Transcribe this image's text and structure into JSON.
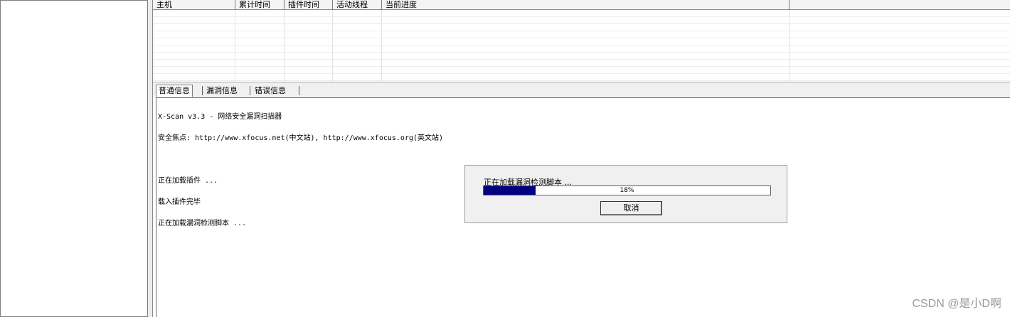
{
  "host_list": {
    "columns": [
      "主机",
      "累计时间",
      "插件时间",
      "活动线程",
      "当前进度",
      ""
    ],
    "rows": []
  },
  "tabs": [
    {
      "label": "普通信息",
      "active": true
    },
    {
      "label": "漏洞信息",
      "active": false
    },
    {
      "label": "错误信息",
      "active": false
    }
  ],
  "log": {
    "lines": [
      "X-Scan v3.3 - 网络安全漏洞扫描器",
      "安全焦点: http://www.xfocus.net(中文站), http://www.xfocus.org(英文站)",
      "",
      "正在加载插件 ...",
      "载入插件完毕",
      "正在加载漏洞检测脚本 ..."
    ]
  },
  "progress_dialog": {
    "message": "正在加载漏洞检测脚本 ...",
    "progress_percent": 18,
    "progress_text": "18%",
    "cancel_label": "取消",
    "fill_color": "#000080"
  },
  "watermark": "CSDN @是小D啊"
}
